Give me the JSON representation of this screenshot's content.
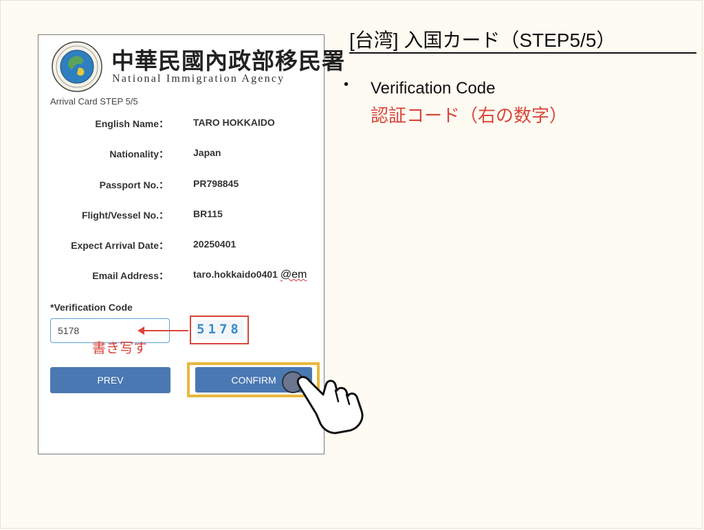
{
  "slide": {
    "title": "[台湾] 入国カード（STEP5/5）",
    "bullet_main": "Verification Code",
    "bullet_sub": "認証コード（右の数字）",
    "bullet_symbol": "•"
  },
  "agency": {
    "name_cn": "中華民國內政部移民署",
    "name_en": "National Immigration Agency"
  },
  "form": {
    "step_label": "Arrival Card STEP 5/5",
    "fields": [
      {
        "label": "English Name：",
        "value": "TARO HOKKAIDO"
      },
      {
        "label": "Nationality：",
        "value": "Japan"
      },
      {
        "label": "Passport No.：",
        "value": "PR798845"
      },
      {
        "label": "Flight/Vessel No.：",
        "value": "BR115"
      },
      {
        "label": "Expect Arrival Date：",
        "value": "20250401"
      },
      {
        "label": "Email Address：",
        "value": "taro.hokkaido0401",
        "suffix": "@em"
      }
    ],
    "verification_label": "*Verification Code",
    "verification_value": "5178",
    "captcha_text": "5178",
    "copy_note": "書き写す",
    "prev_label": "PREV",
    "confirm_label": "CONFIRM"
  },
  "colors": {
    "button_blue": "#4a78b2",
    "annotation_red": "#d9453a",
    "highlight_yellow": "#e8b83c",
    "input_border": "#5b9fd6"
  },
  "icons": {
    "emblem": "agency-emblem-icon",
    "hand": "pointing-hand-icon",
    "arrow": "left-arrow-icon"
  }
}
